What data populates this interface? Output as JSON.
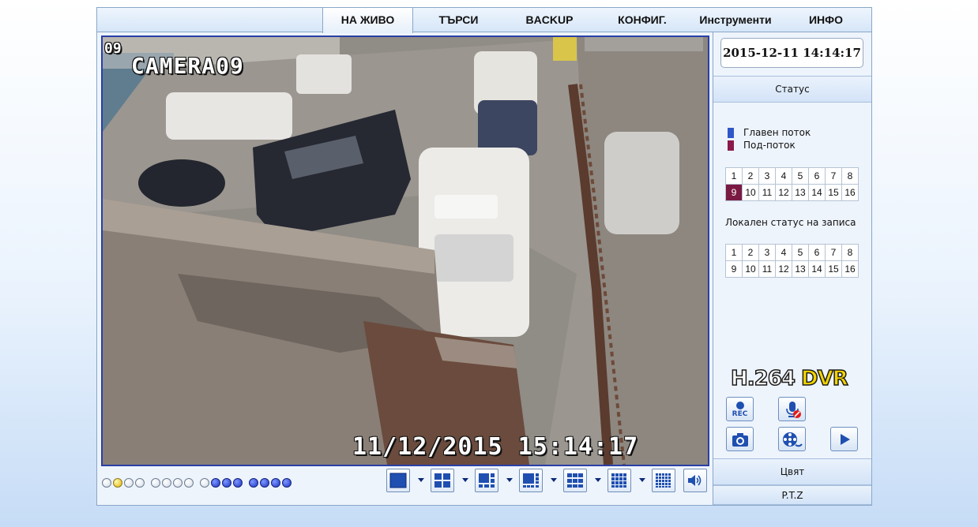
{
  "nav": {
    "tabs": [
      {
        "label": "НА ЖИВО"
      },
      {
        "label": "ТЪРСИ"
      },
      {
        "label": "BACKUP"
      },
      {
        "label": "КОНФИГ."
      },
      {
        "label": "Инструменти"
      },
      {
        "label": "ИНФО"
      }
    ],
    "active_tab": "НА ЖИВО"
  },
  "video": {
    "channel_number": "09",
    "camera_name": "CAMERA09",
    "timestamp": "11/12/2015 15:14:17",
    "border_color": "#2a3fa8"
  },
  "sidebar": {
    "datetime": "2015-12-11 14:14:17",
    "status_header": "Статус",
    "legend": [
      {
        "label": "Главен поток",
        "color": "#2f57c8"
      },
      {
        "label": "Под-поток",
        "color": "#8a1a4a"
      }
    ],
    "stream_channels_row1": [
      "1",
      "2",
      "3",
      "4",
      "5",
      "6",
      "7",
      "8"
    ],
    "stream_channels_row2": [
      "9",
      "10",
      "11",
      "12",
      "13",
      "14",
      "15",
      "16"
    ],
    "active_substream_channel": "9",
    "record_status_label": "Локален статус на записа",
    "record_channels_row1": [
      "1",
      "2",
      "3",
      "4",
      "5",
      "6",
      "7",
      "8"
    ],
    "record_channels_row2": [
      "9",
      "10",
      "11",
      "12",
      "13",
      "14",
      "15",
      "16"
    ],
    "brand_main": "H.264",
    "brand_dvr": "DVR",
    "rec_label": "REC",
    "color_header": "Цвят",
    "ptz_header": "P.T.Z"
  },
  "toolbar": {
    "dot_groups": [
      [
        "white",
        "yellow",
        "white",
        "white"
      ],
      [
        "white",
        "white",
        "white",
        "white"
      ],
      [
        "white",
        "blue",
        "blue",
        "blue"
      ],
      [
        "blue",
        "blue",
        "blue",
        "blue"
      ]
    ],
    "layouts": [
      "1x1",
      "2x2",
      "1+5",
      "1+7",
      "3x3",
      "4x4",
      "5x5"
    ]
  },
  "colors": {
    "accent": "#2a3fa8",
    "active_channel": "#7a1a42"
  }
}
